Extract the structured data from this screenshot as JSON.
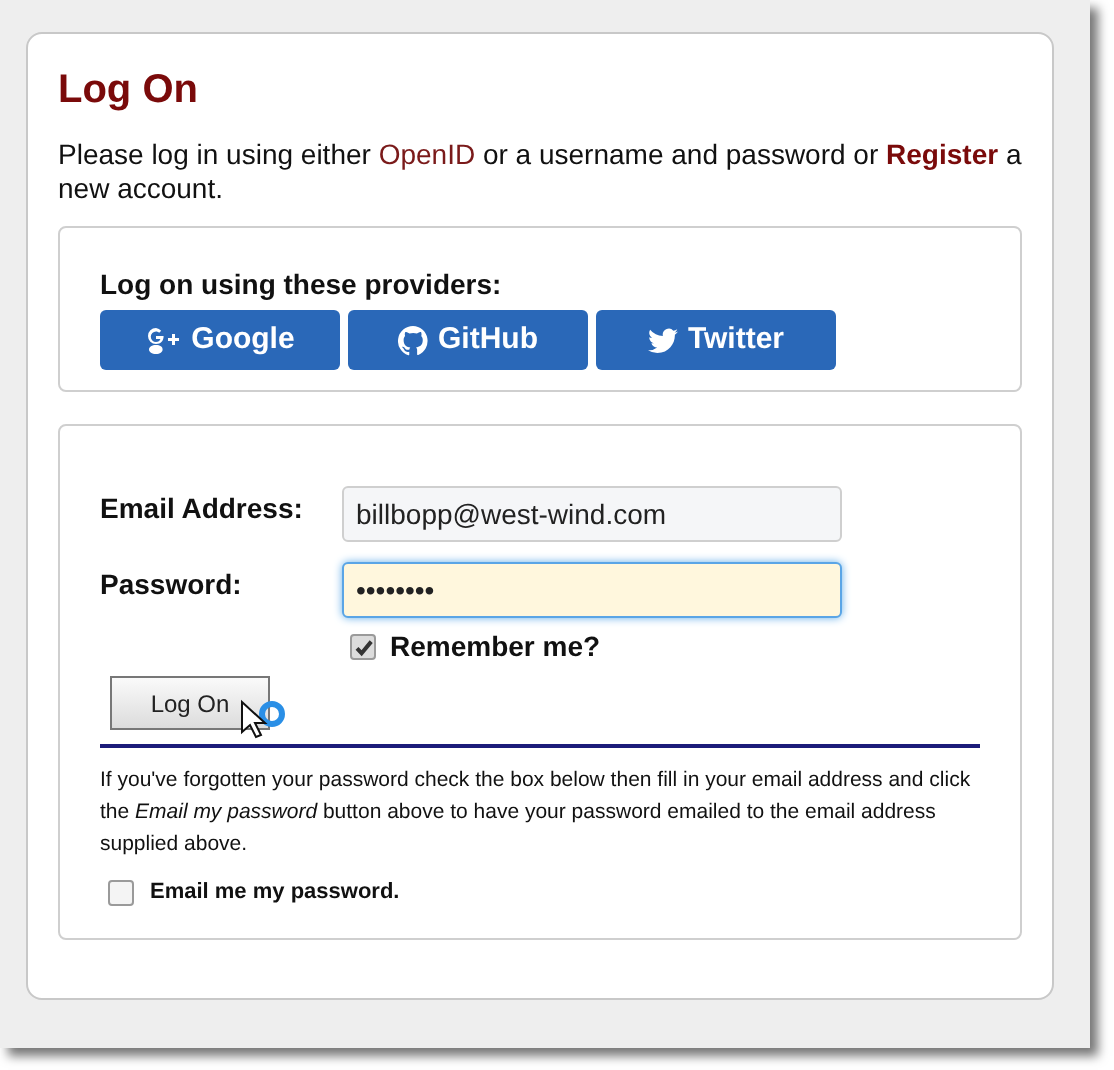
{
  "title": "Log On",
  "intro": {
    "before": "Please log in using either",
    "openid_link": "OpenID",
    "middle": "or a username and password or",
    "register_link": "Register",
    "after": "a new account."
  },
  "providers": {
    "heading": "Log on using these providers:",
    "buttons": [
      {
        "kind": "google",
        "label": "Google"
      },
      {
        "kind": "github",
        "label": "GitHub"
      },
      {
        "kind": "twitter",
        "label": "Twitter"
      }
    ]
  },
  "form": {
    "email": {
      "label": "Email Address:",
      "value": "billbopp@west-wind.com",
      "focused": false
    },
    "password": {
      "label": "Password:",
      "value": "••••••••",
      "focused": true
    },
    "remember": {
      "label": "Remember me?",
      "checked": true
    },
    "submit": "Log On",
    "help": "If you've forgotten your password check the box below then fill in your email address and click the *Email my password* button above to have your password emailed to the email address supplied above.",
    "email_password": {
      "label": "Email me my password.",
      "checked": false
    }
  }
}
